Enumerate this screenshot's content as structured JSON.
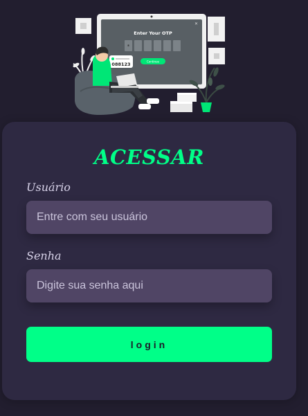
{
  "illustration": {
    "otp_title": "Enter Your OTP",
    "otp_code": "088123",
    "confirm_label": "Continue"
  },
  "login_form": {
    "title": "ACESSAR",
    "username_label": "Usuário",
    "username_placeholder": "Entre com seu usuário",
    "password_label": "Senha",
    "password_placeholder": "Digite sua senha aqui",
    "submit_label": "login"
  },
  "colors": {
    "page_background": "#221e2f",
    "card_background": "#2e2942",
    "input_background": "#504565",
    "accent": "#00ff88"
  }
}
